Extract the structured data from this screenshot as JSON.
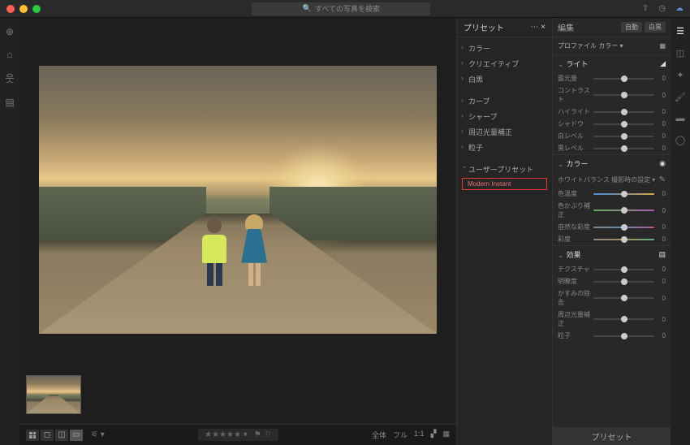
{
  "titlebar": {
    "search_placeholder": "すべての写真を検索"
  },
  "leftbar_icons": [
    "add",
    "home",
    "people",
    "book"
  ],
  "presets": {
    "title": "プリセット",
    "groups": [
      "カラー",
      "クリエイティブ",
      "白黒",
      "カーブ",
      "シャープ",
      "周辺光量補正",
      "粒子"
    ],
    "user_group": "ユーザープリセット",
    "user_items": [
      "Modern Instant"
    ]
  },
  "edit": {
    "title": "編集",
    "auto": "自動",
    "bw": "白黒",
    "profile_label": "プロファイル",
    "profile_value": "カラー",
    "sections": {
      "light": {
        "title": "ライト",
        "sliders": [
          {
            "label": "露光量",
            "value": 0
          },
          {
            "label": "コントラスト",
            "value": 0
          },
          {
            "label": "ハイライト",
            "value": 0
          },
          {
            "label": "シャドウ",
            "value": 0
          },
          {
            "label": "白レベル",
            "value": 0
          },
          {
            "label": "黒レベル",
            "value": 0
          }
        ]
      },
      "color": {
        "title": "カラー",
        "wb_label": "ホワイトバランス",
        "wb_value": "撮影時の設定",
        "sliders": [
          {
            "label": "色温度",
            "value": 0,
            "cls": "temp"
          },
          {
            "label": "色かぶり補正",
            "value": 0,
            "cls": "tint"
          },
          {
            "label": "自然な彩度",
            "value": 0,
            "cls": "vib"
          },
          {
            "label": "彩度",
            "value": 0,
            "cls": "sat"
          }
        ]
      },
      "effects": {
        "title": "効果",
        "sliders": [
          {
            "label": "テクスチャ",
            "value": 0
          },
          {
            "label": "明瞭度",
            "value": 0
          },
          {
            "label": "かすみの除去",
            "value": 0
          },
          {
            "label": "周辺光量補正",
            "value": 0
          },
          {
            "label": "粒子",
            "value": 0
          }
        ]
      }
    },
    "preset_button": "プリセット"
  },
  "bottombar": {
    "zoom": [
      "全体",
      "フル",
      "1:1"
    ]
  }
}
